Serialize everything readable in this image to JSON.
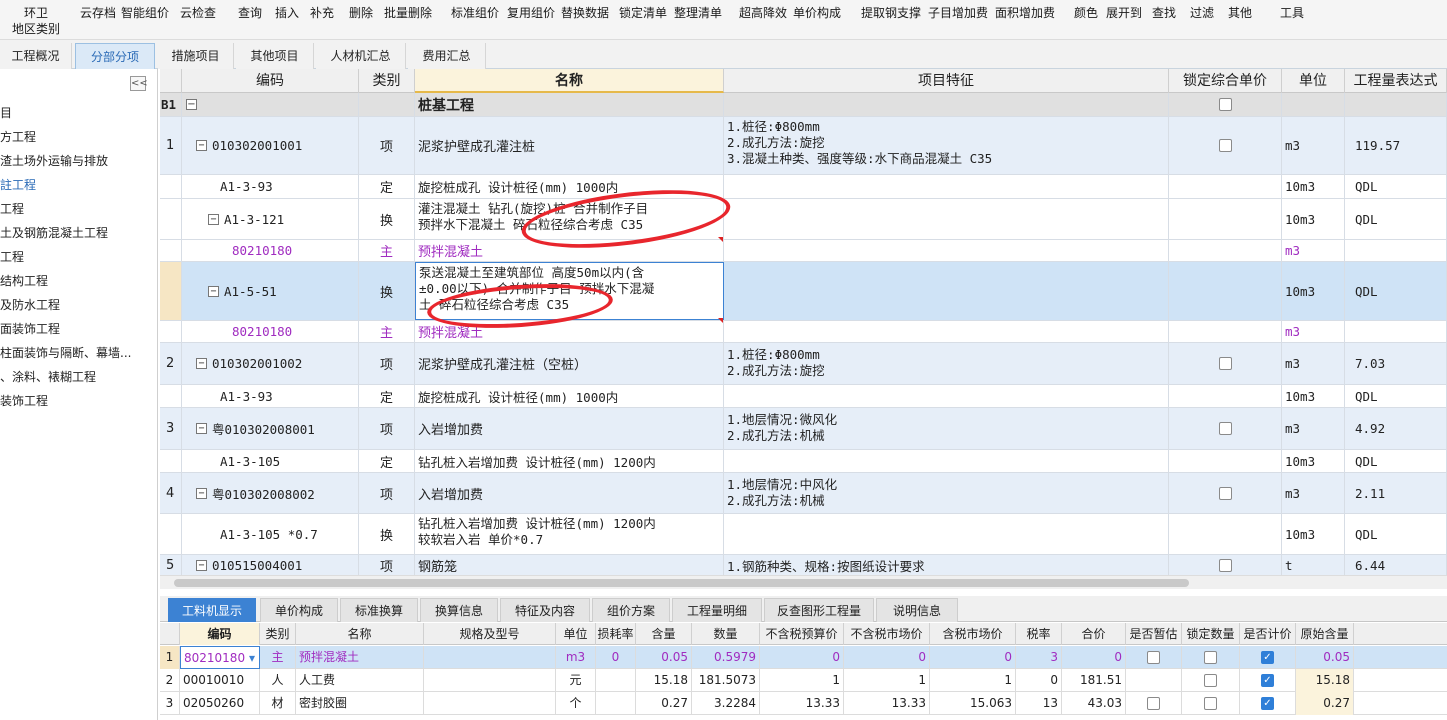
{
  "toolbar": {
    "items": [
      "环卫",
      "地区类别",
      "云存档",
      "智能组价",
      "云检查",
      "查询",
      "插入",
      "补充",
      "删除",
      "批量删除",
      "标准组价",
      "复用组价",
      "替换数据",
      "锁定清单",
      "整理清单",
      "超高降效",
      "单价构成",
      "提取钢支撑",
      "子目增加费",
      "面积增加费",
      "颜色",
      "展开到",
      "查找",
      "过滤",
      "其他",
      "工具"
    ]
  },
  "page_tabs": [
    "工程概况",
    "分部分项",
    "措施项目",
    "其他项目",
    "人材机汇总",
    "费用汇总"
  ],
  "sidebar": {
    "collapse_label": "<<",
    "items": [
      "目",
      "方工程",
      "渣土场外运输与排放",
      "註工程",
      "工程",
      "土及钢筋混凝土工程",
      "工程",
      "结构工程",
      "及防水工程",
      "面装饰工程",
      "柱面装饰与隔断、幕墙...",
      "、涂料、裱糊工程",
      "装饰工程"
    ]
  },
  "grid": {
    "headers": [
      "编码",
      "类别",
      "名称",
      "项目特征",
      "锁定综合单价",
      "单位",
      "工程量表达式"
    ],
    "group": {
      "idx": "B1",
      "name": "桩基工程"
    },
    "rows": [
      {
        "idx": "1",
        "code": "010302001001",
        "type": "项",
        "name": "泥浆护壁成孔灌注桩",
        "feature": "1.桩径:Φ800mm\n2.成孔方法:旋挖\n3.混凝土种类、强度等级:水下商品混凝土 C35",
        "unit": "m3",
        "expr": "119.57"
      },
      {
        "idx": "",
        "code": "A1-3-93",
        "type": "定",
        "name": "旋挖桩成孔 设计桩径(mm) 1000内",
        "feature": "",
        "unit": "10m3",
        "expr": "QDL"
      },
      {
        "idx": "",
        "code": "A1-3-121",
        "type": "换",
        "name": "灌注混凝土 钻孔(旋挖)桩  合并制作子目\n预拌水下混凝土 碎石粒径综合考虑 C35",
        "feature": "",
        "unit": "10m3",
        "expr": "QDL"
      },
      {
        "idx": "",
        "code": "80210180",
        "type": "主",
        "name": "预拌混凝土",
        "feature": "",
        "unit": "m3",
        "expr": ""
      },
      {
        "idx": "",
        "code": "A1-5-51",
        "type": "换",
        "name": "泵送混凝土至建筑部位 高度50m以内(含\n±0.00以下)  合并制作子目 预拌水下混凝\n土 碎石粒径综合考虑 C35",
        "feature": "",
        "unit": "10m3",
        "expr": "QDL"
      },
      {
        "idx": "",
        "code": "80210180",
        "type": "主",
        "name": "预拌混凝土",
        "feature": "",
        "unit": "m3",
        "expr": ""
      },
      {
        "idx": "2",
        "code": "010302001002",
        "type": "项",
        "name": "泥浆护壁成孔灌注桩（空桩）",
        "feature": "1.桩径:Φ800mm\n2.成孔方法:旋挖",
        "unit": "m3",
        "expr": "7.03"
      },
      {
        "idx": "",
        "code": "A1-3-93",
        "type": "定",
        "name": "旋挖桩成孔 设计桩径(mm) 1000内",
        "feature": "",
        "unit": "10m3",
        "expr": "QDL"
      },
      {
        "idx": "3",
        "code": "粤010302008001",
        "type": "项",
        "name": "入岩增加费",
        "feature": "1.地层情况:微风化\n2.成孔方法:机械",
        "unit": "m3",
        "expr": "4.92"
      },
      {
        "idx": "",
        "code": "A1-3-105",
        "type": "定",
        "name": "钻孔桩入岩增加费 设计桩径(mm) 1200内",
        "feature": "",
        "unit": "10m3",
        "expr": "QDL"
      },
      {
        "idx": "4",
        "code": "粤010302008002",
        "type": "项",
        "name": "入岩增加费",
        "feature": "1.地层情况:中风化\n2.成孔方法:机械",
        "unit": "m3",
        "expr": "2.11"
      },
      {
        "idx": "",
        "code": "A1-3-105 *0.7",
        "type": "换",
        "name": "钻孔桩入岩增加费 设计桩径(mm) 1200内\n较软岩入岩 单价*0.7",
        "feature": "",
        "unit": "10m3",
        "expr": "QDL"
      },
      {
        "idx": "5",
        "code": "010515004001",
        "type": "项",
        "name": "钢筋笼",
        "feature": "1.钢筋种类、规格:按图纸设计要求",
        "unit": "t",
        "expr": "6.44"
      }
    ]
  },
  "bottom_tabs": [
    "工料机显示",
    "单价构成",
    "标准换算",
    "换算信息",
    "特征及内容",
    "组价方案",
    "工程量明细",
    "反查图形工程量",
    "说明信息"
  ],
  "lower_grid": {
    "headers": [
      "编码",
      "类别",
      "名称",
      "规格及型号",
      "单位",
      "损耗率",
      "含量",
      "数量",
      "不含税预算价",
      "不含税市场价",
      "含税市场价",
      "税率",
      "合价",
      "是否暂估",
      "锁定数量",
      "是否计价",
      "原始含量"
    ],
    "rows": [
      {
        "idx": "1",
        "code": "80210180",
        "type": "主",
        "name": "预拌混凝土",
        "spec": "",
        "unit": "m3",
        "loss": "0",
        "content": "0.05",
        "qty": "0.5979",
        "pre_price": "0",
        "mkt_price": "0",
        "tax_mkt": "0",
        "tax": "3",
        "total": "0",
        "est": false,
        "lock": false,
        "price": true,
        "orig": "0.05"
      },
      {
        "idx": "2",
        "code": "00010010",
        "type": "人",
        "name": "人工费",
        "spec": "",
        "unit": "元",
        "loss": "",
        "content": "15.18",
        "qty": "181.5073",
        "pre_price": "1",
        "mkt_price": "1",
        "tax_mkt": "1",
        "tax": "0",
        "total": "181.51",
        "est": null,
        "lock": false,
        "price": true,
        "orig": "15.18"
      },
      {
        "idx": "3",
        "code": "02050260",
        "type": "材",
        "name": "密封胶圈",
        "spec": "",
        "unit": "个",
        "loss": "",
        "content": "0.27",
        "qty": "3.2284",
        "pre_price": "13.33",
        "mkt_price": "13.33",
        "tax_mkt": "15.063",
        "tax": "13",
        "total": "43.03",
        "est": false,
        "lock": false,
        "price": true,
        "orig": "0.27"
      }
    ]
  }
}
